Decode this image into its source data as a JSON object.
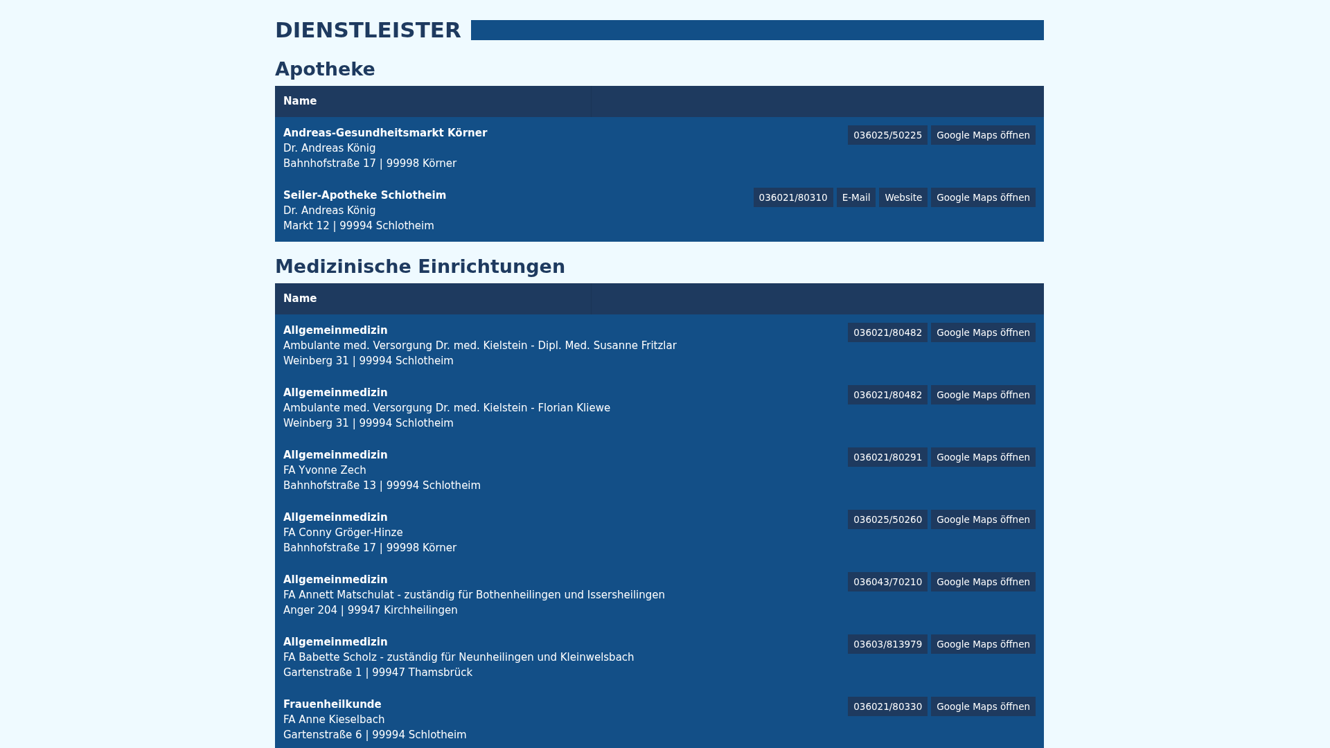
{
  "title": "DIENSTLEISTER",
  "sections": [
    {
      "heading": "Apotheke",
      "columns": [
        "Name"
      ],
      "entries": [
        {
          "name": "Andreas-Gesundheitsmarkt Körner",
          "person": "Dr. Andreas König",
          "address": "Bahnhofstraße 17 | 99998 Körner",
          "actions": [
            "036025/50225",
            "Google Maps öffnen"
          ]
        },
        {
          "name": "Seiler-Apotheke Schlotheim",
          "person": "Dr. Andreas König",
          "address": "Markt 12 | 99994 Schlotheim",
          "actions": [
            "036021/80310",
            "E-Mail",
            "Website",
            "Google Maps öffnen"
          ]
        }
      ]
    },
    {
      "heading": "Medizinische Einrichtungen",
      "columns": [
        "Name"
      ],
      "entries": [
        {
          "name": "Allgemeinmedizin",
          "person": "Ambulante med. Versorgung Dr. med. Kielstein - Dipl. Med. Susanne Fritzlar",
          "address": "Weinberg 31 | 99994 Schlotheim",
          "actions": [
            "036021/80482",
            "Google Maps öffnen"
          ]
        },
        {
          "name": "Allgemeinmedizin",
          "person": "Ambulante med. Versorgung Dr. med. Kielstein - Florian Kliewe",
          "address": "Weinberg 31 | 99994 Schlotheim",
          "actions": [
            "036021/80482",
            "Google Maps öffnen"
          ]
        },
        {
          "name": "Allgemeinmedizin",
          "person": "FA Yvonne Zech",
          "address": "Bahnhofstraße 13 | 99994 Schlotheim",
          "actions": [
            "036021/80291",
            "Google Maps öffnen"
          ]
        },
        {
          "name": "Allgemeinmedizin",
          "person": "FA Conny Gröger-Hinze",
          "address": "Bahnhofstraße 17 | 99998 Körner",
          "actions": [
            "036025/50260",
            "Google Maps öffnen"
          ]
        },
        {
          "name": "Allgemeinmedizin",
          "person": "FA Annett Matschulat - zuständig für Bothenheilingen und Issersheilingen",
          "address": "Anger 204 | 99947 Kirchheilingen",
          "actions": [
            "036043/70210",
            "Google Maps öffnen"
          ]
        },
        {
          "name": "Allgemeinmedizin",
          "person": "FA Babette Scholz - zuständig für Neunheilingen und Kleinwelsbach",
          "address": "Gartenstraße 1 | 99947 Thamsbrück",
          "actions": [
            "03603/813979",
            "Google Maps öffnen"
          ]
        },
        {
          "name": "Frauenheilkunde",
          "person": "FA Anne Kieselbach",
          "address": "Gartenstraße 6 | 99994 Schlotheim",
          "actions": [
            "036021/80330",
            "Google Maps öffnen"
          ]
        }
      ]
    }
  ]
}
